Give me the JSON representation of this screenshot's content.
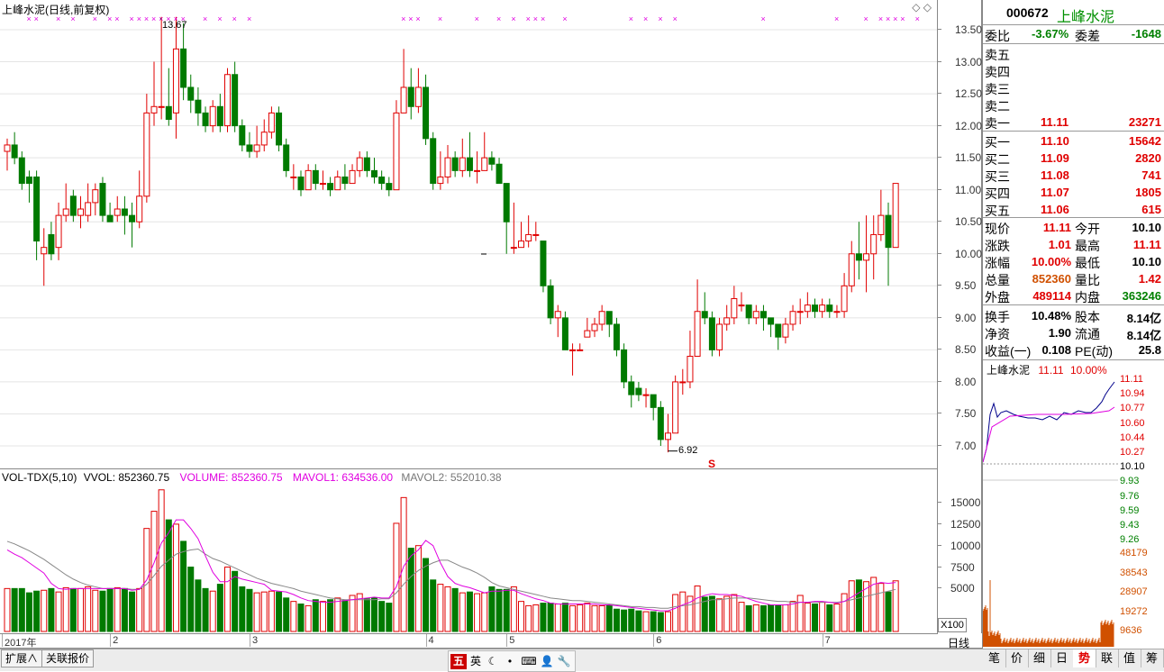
{
  "main_chart": {
    "title": "上峰水泥(日线,前复权)",
    "high_label": "13.67",
    "low_label": "6.92",
    "marker_s": "S",
    "y_ticks": [
      "13.50",
      "13.00",
      "12.50",
      "12.00",
      "11.50",
      "11.00",
      "10.50",
      "10.00",
      "9.50",
      "9.00",
      "8.50",
      "8.00",
      "7.50",
      "7.00"
    ]
  },
  "volume_chart": {
    "name_label": "VOL-TDX(5,10)",
    "vvol_label": "VVOL: 852360.75",
    "volume_label": "VOLUME: 852360.75",
    "mavol1_label": "MAVOL1: 634536.00",
    "mavol2_label": "MAVOL2: 552010.38",
    "y_ticks": [
      "15000",
      "12500",
      "10000",
      "7500",
      "5000"
    ],
    "unit_label": "X100"
  },
  "x_axis": {
    "labels": [
      "2017年",
      "2",
      "3",
      "4",
      "5",
      "6",
      "7"
    ],
    "period_label": "日线"
  },
  "chart_data": {
    "type": "candlestick",
    "title": "上峰水泥(日线,前复权)",
    "ylim": [
      6.7,
      13.7
    ],
    "volume_ylim": [
      0,
      17000
    ],
    "candles": [
      [
        11.6,
        11.7,
        11.8,
        11.3
      ],
      [
        11.7,
        11.5,
        11.9,
        11.4
      ],
      [
        11.5,
        11.1,
        11.6,
        11.0
      ],
      [
        11.2,
        11.1,
        11.3,
        10.8
      ],
      [
        11.2,
        10.2,
        11.3,
        9.9
      ],
      [
        10.0,
        10.1,
        10.4,
        9.5
      ],
      [
        10.3,
        10.0,
        10.5,
        9.9
      ],
      [
        10.1,
        10.6,
        10.8,
        9.9
      ],
      [
        10.6,
        10.7,
        11.1,
        10.5
      ],
      [
        10.9,
        10.6,
        11.0,
        10.5
      ],
      [
        10.6,
        10.7,
        10.9,
        10.4
      ],
      [
        10.6,
        10.8,
        11.1,
        10.5
      ],
      [
        10.8,
        11.0,
        11.1,
        10.6
      ],
      [
        11.1,
        10.6,
        11.2,
        10.5
      ],
      [
        10.6,
        10.5,
        10.8,
        10.5
      ],
      [
        10.6,
        10.7,
        10.9,
        10.5
      ],
      [
        10.7,
        10.6,
        10.9,
        10.3
      ],
      [
        10.6,
        10.5,
        10.8,
        10.1
      ],
      [
        10.5,
        10.9,
        11.3,
        10.4
      ],
      [
        10.9,
        12.2,
        12.5,
        10.8
      ],
      [
        12.2,
        12.3,
        13.0,
        12.0
      ],
      [
        12.3,
        12.3,
        13.7,
        12.1
      ],
      [
        12.3,
        12.1,
        12.9,
        12.0
      ],
      [
        12.2,
        13.2,
        13.7,
        11.8
      ],
      [
        13.2,
        12.6,
        13.6,
        12.4
      ],
      [
        12.6,
        12.4,
        12.8,
        12.2
      ],
      [
        12.4,
        12.2,
        12.6,
        12.0
      ],
      [
        12.2,
        12.0,
        12.3,
        11.9
      ],
      [
        12.0,
        12.3,
        12.4,
        11.9
      ],
      [
        12.3,
        12.0,
        12.5,
        11.9
      ],
      [
        12.0,
        12.8,
        12.9,
        11.9
      ],
      [
        12.8,
        12.0,
        13.0,
        11.9
      ],
      [
        12.0,
        11.7,
        12.1,
        11.6
      ],
      [
        11.7,
        11.6,
        11.9,
        11.5
      ],
      [
        11.6,
        11.7,
        12.0,
        11.5
      ],
      [
        11.7,
        11.9,
        12.1,
        11.6
      ],
      [
        11.9,
        12.2,
        12.3,
        11.8
      ],
      [
        12.2,
        11.7,
        12.3,
        11.6
      ],
      [
        11.7,
        11.3,
        11.8,
        11.2
      ],
      [
        11.2,
        11.2,
        11.4,
        11.0
      ],
      [
        11.2,
        11.0,
        11.3,
        10.9
      ],
      [
        11.0,
        11.3,
        11.4,
        11.0
      ],
      [
        11.3,
        11.1,
        11.4,
        11.0
      ],
      [
        11.1,
        11.1,
        11.3,
        11.0
      ],
      [
        11.1,
        11.0,
        11.2,
        10.9
      ],
      [
        11.0,
        11.2,
        11.3,
        11.0
      ],
      [
        11.2,
        11.1,
        11.4,
        11.0
      ],
      [
        11.1,
        11.3,
        11.4,
        11.1
      ],
      [
        11.3,
        11.5,
        11.6,
        11.2
      ],
      [
        11.5,
        11.3,
        11.6,
        11.2
      ],
      [
        11.3,
        11.2,
        11.5,
        11.1
      ],
      [
        11.2,
        11.1,
        11.3,
        11.0
      ],
      [
        11.1,
        11.0,
        11.2,
        10.9
      ],
      [
        11.0,
        12.2,
        12.4,
        11.0
      ],
      [
        12.2,
        12.6,
        13.2,
        12.2
      ],
      [
        12.6,
        12.3,
        12.9,
        12.1
      ],
      [
        12.3,
        12.6,
        12.9,
        12.2
      ],
      [
        12.6,
        11.8,
        12.8,
        11.7
      ],
      [
        11.8,
        11.1,
        11.9,
        11.0
      ],
      [
        11.1,
        11.2,
        11.6,
        11.0
      ],
      [
        11.2,
        11.5,
        11.7,
        11.1
      ],
      [
        11.5,
        11.3,
        11.6,
        11.2
      ],
      [
        11.3,
        11.5,
        11.8,
        11.2
      ],
      [
        11.5,
        11.3,
        11.9,
        11.2
      ],
      [
        11.3,
        11.3,
        11.6,
        11.1
      ],
      [
        11.3,
        11.5,
        11.9,
        11.3
      ],
      [
        11.5,
        11.4,
        11.6,
        11.3
      ],
      [
        11.4,
        11.1,
        11.5,
        11.1
      ],
      [
        11.1,
        10.5,
        10.9,
        10.0
      ],
      [
        10.1,
        10.1,
        10.8,
        10.0
      ],
      [
        10.1,
        10.2,
        10.5,
        10.1
      ],
      [
        10.2,
        10.3,
        10.6,
        10.1
      ],
      [
        10.3,
        10.3,
        10.5,
        10.2
      ],
      [
        10.2,
        9.5,
        10.2,
        9.4
      ],
      [
        9.5,
        9.0,
        9.6,
        8.9
      ],
      [
        9.0,
        9.1,
        9.2,
        8.7
      ],
      [
        9.0,
        8.5,
        9.1,
        8.5
      ],
      [
        8.5,
        8.5,
        8.6,
        8.1
      ],
      [
        8.5,
        8.5,
        8.6,
        8.5
      ],
      [
        8.7,
        8.8,
        9.0,
        8.7
      ],
      [
        8.8,
        8.9,
        9.0,
        8.7
      ],
      [
        8.9,
        9.1,
        9.2,
        8.8
      ],
      [
        9.1,
        8.9,
        9.1,
        8.7
      ],
      [
        8.9,
        8.5,
        9.0,
        8.4
      ],
      [
        8.5,
        8.0,
        8.6,
        7.9
      ],
      [
        8.0,
        7.8,
        8.1,
        7.6
      ],
      [
        7.9,
        7.8,
        8.0,
        7.7
      ],
      [
        7.8,
        7.8,
        7.9,
        7.6
      ],
      [
        7.8,
        7.6,
        7.8,
        7.4
      ],
      [
        7.6,
        7.1,
        7.7,
        7.0
      ],
      [
        7.1,
        7.2,
        7.5,
        6.9
      ],
      [
        7.2,
        8.0,
        8.1,
        7.2
      ],
      [
        8.0,
        8.0,
        8.2,
        7.8
      ],
      [
        8.0,
        8.4,
        8.8,
        7.9
      ],
      [
        8.4,
        9.1,
        9.6,
        8.4
      ],
      [
        9.1,
        9.0,
        9.4,
        8.9
      ],
      [
        9.0,
        8.5,
        9.1,
        8.4
      ],
      [
        8.5,
        8.9,
        9.0,
        8.4
      ],
      [
        8.9,
        9.0,
        9.2,
        8.8
      ],
      [
        9.0,
        9.3,
        9.5,
        8.9
      ],
      [
        9.2,
        9.2,
        9.4,
        9.1
      ],
      [
        9.2,
        9.0,
        9.2,
        8.9
      ],
      [
        9.0,
        9.1,
        9.2,
        8.9
      ],
      [
        9.1,
        9.0,
        9.2,
        8.8
      ],
      [
        9.0,
        8.9,
        9.0,
        8.7
      ],
      [
        8.9,
        8.7,
        8.9,
        8.5
      ],
      [
        8.7,
        8.9,
        9.0,
        8.6
      ],
      [
        8.9,
        9.1,
        9.2,
        8.8
      ],
      [
        9.1,
        9.1,
        9.3,
        8.9
      ],
      [
        9.1,
        9.2,
        9.4,
        9.0
      ],
      [
        9.2,
        9.1,
        9.3,
        9.0
      ],
      [
        9.1,
        9.2,
        9.3,
        9.0
      ],
      [
        9.2,
        9.1,
        9.3,
        9.0
      ],
      [
        9.1,
        9.1,
        9.2,
        9.0
      ],
      [
        9.1,
        9.5,
        9.7,
        9.0
      ],
      [
        9.5,
        10.0,
        10.2,
        9.4
      ],
      [
        10.0,
        9.9,
        10.5,
        9.6
      ],
      [
        9.9,
        10.0,
        10.6,
        9.4
      ],
      [
        10.0,
        10.3,
        10.6,
        9.6
      ],
      [
        10.3,
        10.6,
        11.0,
        10.2
      ],
      [
        10.6,
        10.1,
        10.8,
        9.5
      ],
      [
        10.1,
        11.1,
        11.1,
        10.1
      ]
    ],
    "volume": [
      5000,
      5000,
      5000,
      4500,
      4700,
      4800,
      5000,
      4600,
      5100,
      5000,
      5000,
      5200,
      4800,
      4700,
      5000,
      5100,
      5000,
      4600,
      5000,
      12000,
      14000,
      16500,
      13000,
      12500,
      10500,
      7500,
      6000,
      5000,
      4700,
      5500,
      7500,
      7000,
      5200,
      4900,
      4500,
      4600,
      4700,
      4600,
      3900,
      3500,
      3200,
      3000,
      3700,
      3500,
      3700,
      3900,
      3600,
      4200,
      4400,
      3800,
      3900,
      3500,
      3300,
      12600,
      15600,
      9700,
      10000,
      8500,
      6000,
      5500,
      5200,
      5000,
      4500,
      4600,
      4400,
      4500,
      5200,
      4900,
      4900,
      5200,
      3500,
      3000,
      3100,
      3300,
      3300,
      3200,
      3300,
      3000,
      3100,
      3300,
      3000,
      3000,
      3000,
      2600,
      2500,
      2600,
      2400,
      2300,
      2300,
      2200,
      2300,
      4300,
      4600,
      4100,
      5300,
      4000,
      4100,
      3800,
      4100,
      4300,
      3400,
      3000,
      3100,
      3000,
      3100,
      3000,
      3100,
      3500,
      4200,
      3300,
      3200,
      3400,
      3100,
      3200,
      4400,
      5900,
      6000,
      5800,
      6300,
      5600,
      4600,
      5900
    ],
    "mavol1": [
      9500,
      9000,
      8600,
      8000,
      7400,
      6800,
      5600,
      5000,
      4900,
      5000,
      5000,
      5000,
      5000,
      5000,
      5000,
      5000,
      5000,
      4800,
      4900,
      6000,
      8000,
      10300,
      11500,
      13000,
      13000,
      12000,
      10800,
      8800,
      6900,
      5800,
      5800,
      6400,
      6100,
      5900,
      5700,
      5500,
      4800,
      4700,
      4600,
      4300,
      3900,
      3600,
      3500,
      3400,
      3400,
      3500,
      3600,
      3700,
      3800,
      3900,
      4000,
      3900,
      3900,
      5200,
      7600,
      8800,
      9500,
      10600,
      10000,
      8000,
      6400,
      5600,
      5300,
      5100,
      4800,
      4500,
      4700,
      4700,
      4800,
      4800,
      4400,
      4100,
      3800,
      3600,
      3300,
      3200,
      3200,
      3200,
      3200,
      3200,
      3200,
      3100,
      3100,
      3000,
      2900,
      2800,
      2700,
      2600,
      2500,
      2400,
      2400,
      2700,
      3100,
      3400,
      3900,
      4200,
      4400,
      4300,
      4300,
      4200,
      4100,
      3800,
      3500,
      3300,
      3100,
      3100,
      3100,
      3200,
      3400,
      3400,
      3500,
      3500,
      3400,
      3300,
      3500,
      4000,
      4500,
      5000,
      5500,
      5700,
      5600,
      5700
    ],
    "mavol2": [
      10500,
      10200,
      9800,
      9400,
      8900,
      8400,
      7800,
      7200,
      6600,
      6100,
      5700,
      5400,
      5200,
      5000,
      5000,
      5000,
      5000,
      4900,
      4900,
      5500,
      6500,
      7600,
      8300,
      9000,
      9300,
      9500,
      9600,
      9000,
      8500,
      8200,
      7800,
      7400,
      7000,
      6600,
      6200,
      5900,
      5600,
      5400,
      5200,
      5000,
      4700,
      4500,
      4300,
      4100,
      3900,
      3800,
      3700,
      3700,
      3700,
      3700,
      3700,
      3800,
      3800,
      4500,
      5500,
      6400,
      7100,
      7600,
      8000,
      8300,
      8300,
      7900,
      7500,
      7200,
      6800,
      6300,
      5700,
      5300,
      5100,
      4900,
      4700,
      4500,
      4300,
      4100,
      3900,
      3800,
      3700,
      3600,
      3600,
      3500,
      3400,
      3300,
      3200,
      3100,
      3000,
      2900,
      2900,
      2800,
      2800,
      2700,
      2700,
      2900,
      3000,
      3100,
      3300,
      3500,
      3700,
      3700,
      3800,
      3900,
      3900,
      3900,
      3800,
      3700,
      3600,
      3500,
      3500,
      3400,
      3400,
      3400,
      3400,
      3400,
      3400,
      3400,
      3500,
      3700,
      3900,
      4100,
      4300,
      4500,
      4700,
      4900
    ],
    "marks_x": [
      3,
      4,
      7,
      9,
      12,
      14,
      15,
      17,
      18,
      19,
      20,
      21,
      22,
      23,
      24,
      27,
      29,
      31,
      33,
      54,
      55,
      56,
      59,
      64,
      67,
      69,
      71,
      72,
      73,
      76,
      85,
      87,
      89,
      91,
      103,
      113,
      117,
      119,
      120,
      121,
      122,
      124
    ]
  },
  "quote": {
    "code": "000672",
    "name": "上峰水泥",
    "weibi_label": "委比",
    "weibi_value": "-3.67%",
    "weicha_label": "委差",
    "weicha_value": "-1648",
    "sells": [
      {
        "label": "卖五",
        "price": "",
        "vol": ""
      },
      {
        "label": "卖四",
        "price": "",
        "vol": ""
      },
      {
        "label": "卖三",
        "price": "",
        "vol": ""
      },
      {
        "label": "卖二",
        "price": "",
        "vol": ""
      },
      {
        "label": "卖一",
        "price": "11.11",
        "vol": "23271"
      }
    ],
    "buys": [
      {
        "label": "买一",
        "price": "11.10",
        "vol": "15642"
      },
      {
        "label": "买二",
        "price": "11.09",
        "vol": "2820"
      },
      {
        "label": "买三",
        "price": "11.08",
        "vol": "741"
      },
      {
        "label": "买四",
        "price": "11.07",
        "vol": "1805"
      },
      {
        "label": "买五",
        "price": "11.06",
        "vol": "615"
      }
    ],
    "stats": [
      {
        "l1": "现价",
        "v1": "11.11",
        "c1": "red",
        "l2": "今开",
        "v2": "10.10",
        "c2": "black"
      },
      {
        "l1": "涨跌",
        "v1": "1.01",
        "c1": "red",
        "l2": "最高",
        "v2": "11.11",
        "c2": "red"
      },
      {
        "l1": "涨幅",
        "v1": "10.00%",
        "c1": "red",
        "l2": "最低",
        "v2": "10.10",
        "c2": "black"
      },
      {
        "l1": "总量",
        "v1": "852360",
        "c1": "orange",
        "l2": "量比",
        "v2": "1.42",
        "c2": "red"
      },
      {
        "l1": "外盘",
        "v1": "489114",
        "c1": "red",
        "l2": "内盘",
        "v2": "363246",
        "c2": "green"
      }
    ],
    "stats2": [
      {
        "l1": "换手",
        "v1": "10.48%",
        "l2": "股本",
        "v2": "8.14亿"
      },
      {
        "l1": "净资",
        "v1": "1.90",
        "l2": "流通",
        "v2": "8.14亿"
      },
      {
        "l1": "收益(一)",
        "v1": "0.108",
        "l2": "PE(动)",
        "v2": "25.8"
      }
    ]
  },
  "mini_chart": {
    "title": "上峰水泥",
    "price": "11.11",
    "pct": "10.00%",
    "price_ticks": [
      "11.11",
      "10.94",
      "10.77",
      "10.60",
      "10.44",
      "10.27",
      "10.10",
      "9.93",
      "9.76",
      "9.59",
      "9.43",
      "9.26"
    ],
    "vol_ticks": [
      "48179",
      "38543",
      "28907",
      "19272",
      "9636"
    ]
  },
  "bottom": {
    "left_tabs": [
      "扩展∧",
      "关联报价"
    ],
    "right_tabs": [
      "笔",
      "价",
      "细",
      "日",
      "势",
      "联",
      "值",
      "筹"
    ],
    "active_right_tab": "势",
    "tools": [
      "五",
      "英",
      "☾",
      "•",
      "⌨",
      "👤",
      "🔧"
    ]
  },
  "colors": {
    "up": "#e00000",
    "down": "#007a00",
    "ma1": "#e000e0",
    "ma2": "#888888",
    "accent": "#e00000"
  }
}
